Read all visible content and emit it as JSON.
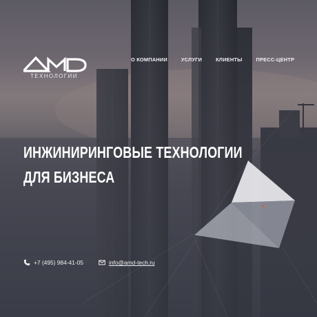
{
  "brand": {
    "logo_text": "AMD",
    "tagline": "ТЕХНОЛОГИИ"
  },
  "nav": {
    "items": [
      {
        "label": "О КОМПАНИИ"
      },
      {
        "label": "УСЛУГИ"
      },
      {
        "label": "КЛИЕНТЫ"
      },
      {
        "label": "ПРЕСС-ЦЕНТР"
      }
    ]
  },
  "hero": {
    "headline_line1": "ИНЖИНИРИНГОВЫЕ ТЕХНОЛОГИИ",
    "headline_line2": "ДЛЯ БИЗНЕСА"
  },
  "contacts": {
    "phone": "+7 (495) 984-41-05",
    "email": "info@amd-tech.ru"
  },
  "colors": {
    "text": "#ffffff",
    "overlay": "#3a3d48"
  }
}
